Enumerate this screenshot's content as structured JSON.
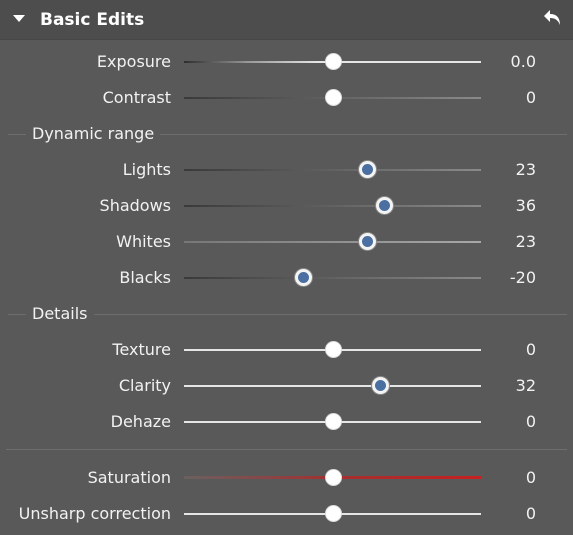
{
  "panel": {
    "title": "Basic Edits",
    "undo_icon": "undo-arrow-icon",
    "caret_icon": "triangle-down-icon"
  },
  "sliders": [
    {
      "key": "exposure",
      "label": "Exposure",
      "value": "0.0",
      "position": 0.5
    },
    {
      "key": "contrast",
      "label": "Contrast",
      "value": "0",
      "position": 0.5
    }
  ],
  "dynamic_range": {
    "title": "Dynamic range",
    "sliders": [
      {
        "key": "lights",
        "label": "Lights",
        "value": "23",
        "position": 0.615
      },
      {
        "key": "shadows",
        "label": "Shadows",
        "value": "36",
        "position": 0.675
      },
      {
        "key": "whites",
        "label": "Whites",
        "value": "23",
        "position": 0.615
      },
      {
        "key": "blacks",
        "label": "Blacks",
        "value": "-20",
        "position": 0.4
      }
    ]
  },
  "details": {
    "title": "Details",
    "sliders": [
      {
        "key": "texture",
        "label": "Texture",
        "value": "0",
        "position": 0.5
      },
      {
        "key": "clarity",
        "label": "Clarity",
        "value": "32",
        "position": 0.66
      },
      {
        "key": "dehaze",
        "label": "Dehaze",
        "value": "0",
        "position": 0.5
      }
    ]
  },
  "color": {
    "sliders": [
      {
        "key": "saturation",
        "label": "Saturation",
        "value": "0",
        "position": 0.5
      },
      {
        "key": "unsharp",
        "label": "Unsharp correction",
        "value": "0",
        "position": 0.5
      }
    ]
  },
  "colors": {
    "panel_bg": "#595959",
    "header_bg": "#4d4d4d",
    "active_thumb": "#4a6fa0",
    "saturation_track": "#c82020"
  }
}
